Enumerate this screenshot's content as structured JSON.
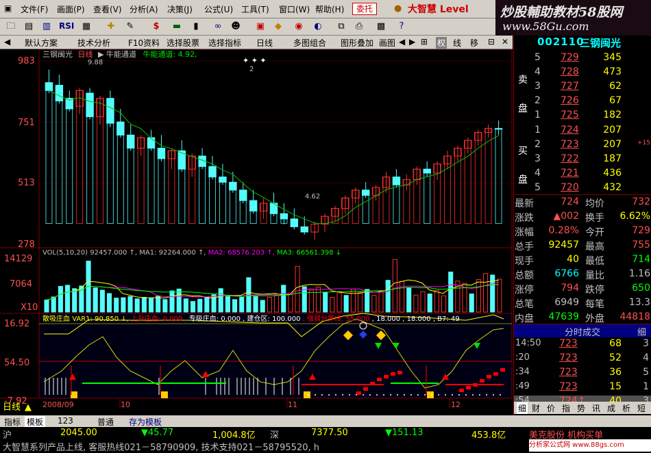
{
  "menu": [
    "文件(F)",
    "画面(P)",
    "查看(V)",
    "分析(A)",
    "决策(J)",
    "公式(U)",
    "工具(T)",
    "窗口(W)",
    "帮助(H)"
  ],
  "entrust": "委托",
  "brand": "大智慧 Level",
  "banner": {
    "text": "炒股輔助教材58股网",
    "url": "www.58Gu.com"
  },
  "tabs": [
    "默认方案",
    "技术分析",
    "F10资料",
    "选择股票",
    "选择指标",
    "日线",
    "多图组合",
    "图形叠加",
    "画图"
  ],
  "side_tabs": [
    "权",
    "线",
    "移"
  ],
  "stock": {
    "code": "002110",
    "name": "三钢闽光"
  },
  "chart": {
    "title": "三钢闽光",
    "period": "日线",
    "indicator_label": "牛能通道",
    "indicator_value": "牛能通道: 4.92,",
    "high_mark": "9.88",
    "low_mark": "4.62",
    "top_mark": "2"
  },
  "chart_data": [
    {
      "type": "bar",
      "name": "price",
      "yticks": [
        "983",
        "751",
        "513",
        "278"
      ],
      "ylim": [
        278,
        983
      ],
      "candles": [
        [
          900,
          950,
          860,
          870
        ],
        [
          890,
          930,
          820,
          830
        ],
        [
          840,
          870,
          790,
          800
        ],
        [
          810,
          880,
          780,
          870
        ],
        [
          860,
          880,
          760,
          770
        ],
        [
          770,
          850,
          740,
          840
        ],
        [
          840,
          870,
          730,
          745
        ],
        [
          750,
          800,
          690,
          700
        ],
        [
          700,
          740,
          640,
          650
        ],
        [
          650,
          700,
          620,
          690
        ],
        [
          690,
          720,
          640,
          650
        ],
        [
          650,
          700,
          600,
          610
        ],
        [
          610,
          650,
          570,
          640
        ],
        [
          640,
          680,
          560,
          570
        ],
        [
          570,
          630,
          540,
          620
        ],
        [
          620,
          650,
          570,
          580
        ],
        [
          580,
          620,
          530,
          540
        ],
        [
          540,
          590,
          510,
          520
        ],
        [
          520,
          560,
          480,
          490
        ],
        [
          490,
          520,
          440,
          450
        ],
        [
          450,
          490,
          400,
          410
        ],
        [
          410,
          460,
          380,
          440
        ],
        [
          440,
          480,
          390,
          400
        ],
        [
          400,
          440,
          360,
          380
        ],
        [
          380,
          420,
          340,
          350
        ],
        [
          350,
          390,
          320,
          330
        ],
        [
          330,
          370,
          300,
          360
        ],
        [
          360,
          400,
          330,
          390
        ],
        [
          390,
          430,
          370,
          420
        ],
        [
          420,
          470,
          400,
          460
        ],
        [
          460,
          500,
          440,
          490
        ],
        [
          490,
          520,
          460,
          470
        ],
        [
          470,
          510,
          450,
          500
        ],
        [
          500,
          560,
          480,
          540
        ],
        [
          540,
          570,
          500,
          510
        ],
        [
          510,
          550,
          490,
          530
        ],
        [
          530,
          580,
          510,
          570
        ],
        [
          570,
          600,
          540,
          555
        ],
        [
          555,
          600,
          530,
          590
        ],
        [
          590,
          640,
          570,
          620
        ],
        [
          620,
          660,
          600,
          650
        ],
        [
          650,
          690,
          630,
          680
        ],
        [
          680,
          720,
          660,
          710
        ],
        [
          710,
          740,
          690,
          725
        ],
        [
          725,
          755,
          700,
          724
        ]
      ]
    },
    {
      "type": "bar",
      "name": "volume",
      "title": "VOL(5,10,20)",
      "values": {
        "vol": "92457.000",
        "ma1": "92264.000",
        "ma2": "68576.203",
        "ma3": "66561.398"
      },
      "yticks": [
        "14129",
        "7064",
        "X10"
      ],
      "ylim": [
        0,
        14129
      ],
      "bars": [
        3200,
        4000,
        6800,
        7100,
        6200,
        6900,
        13500,
        6400,
        5800,
        4900,
        3700,
        3800,
        4100,
        3500,
        3900,
        3600,
        4200,
        3300,
        5600,
        6100,
        3500,
        2800,
        3400,
        3900,
        4600,
        6200,
        4100,
        3300,
        3900,
        9100,
        4100,
        3100,
        3900,
        4500,
        7100,
        4900,
        12100,
        6700,
        5800,
        6600,
        5200,
        3900,
        5100,
        4400,
        6100,
        5200,
        6000,
        4400,
        5500,
        8400,
        13900,
        8100,
        6500,
        4500,
        5400,
        4800,
        5700,
        4300,
        10600,
        8200,
        7600,
        4800,
        8600,
        10200,
        9800,
        8700
      ]
    },
    {
      "type": "line",
      "name": "indicator",
      "title": "散吸庄血",
      "values": {
        "var1": "90.850",
        "shang": "0.000",
        "zhuanqu": "0.000",
        "jian": "100.000",
        "qiangshi": "55.000",
        "a": "18.000",
        "b": "18.000",
        "b7": "49"
      },
      "yticks": [
        "16.92",
        "54.50",
        "-7.92"
      ],
      "ylim": [
        -7.92,
        100
      ]
    }
  ],
  "xaxis": [
    "日线",
    "2008/09",
    "10",
    "11",
    "12"
  ],
  "orderbook": {
    "sell_label": "卖盘",
    "buy_label": "买盘",
    "sell": [
      [
        "5",
        "729",
        "345"
      ],
      [
        "4",
        "728",
        "473"
      ],
      [
        "3",
        "727",
        "62"
      ],
      [
        "2",
        "726",
        "67"
      ],
      [
        "1",
        "725",
        "182"
      ]
    ],
    "buy": [
      [
        "1",
        "724",
        "207"
      ],
      [
        "2",
        "723",
        "207"
      ],
      [
        "3",
        "722",
        "187"
      ],
      [
        "4",
        "721",
        "436"
      ],
      [
        "5",
        "720",
        "432"
      ]
    ],
    "side_mark": "+15"
  },
  "quote": [
    [
      "最新",
      "724",
      "均价",
      "732"
    ],
    [
      "涨跌",
      "▲002",
      "换手",
      "6.62%"
    ],
    [
      "涨幅",
      "0.28%",
      "今开",
      "729"
    ],
    [
      "总手",
      "92457",
      "最高",
      "755"
    ],
    [
      "现手",
      "40",
      "最低",
      "714"
    ],
    [
      "总额",
      "6766",
      "量比",
      "1.16"
    ],
    [
      "涨停",
      "794",
      "跌停",
      "650"
    ],
    [
      "总笔",
      "6949",
      "每笔",
      "13.3"
    ],
    [
      "内盘",
      "47639",
      "外盘",
      "44818"
    ]
  ],
  "trades_title": "分时成交",
  "trades_tab": "细",
  "trades": [
    [
      "14:50",
      "723",
      "68",
      "3"
    ],
    [
      ":20",
      "723",
      "52",
      "4"
    ],
    [
      ":34",
      "723",
      "36",
      "5"
    ],
    [
      ":49",
      "723",
      "15",
      "1"
    ],
    [
      ":54",
      "724↑",
      "40",
      "3"
    ]
  ],
  "bottom_tabs": [
    "指标",
    "模板",
    "123",
    "普通",
    "存为模板"
  ],
  "right_tabs": [
    "细",
    "财",
    "价",
    "指",
    "势",
    "讯",
    "成",
    "析",
    "短"
  ],
  "status": {
    "sh_label": "沪",
    "sh_index": "2045.00",
    "sh_change": "▼45.77",
    "sh_amount": "1,004.8亿",
    "sz_label": "深",
    "sz_index": "7377.50",
    "sz_change": "▼151.13",
    "sz_amount": "453.8亿",
    "ticker": "美克股份 机构买单",
    "hotline": "大智慧系列产品上线, 客服热线021－58790909, 技术支持021－58795520, h",
    "watermark": "分析家公式网 www.88gs.com"
  },
  "colors": {
    "up": "#ff3030",
    "down": "#54fcfc",
    "ma": "#c8c8c8",
    "accent": "#ffff00"
  }
}
